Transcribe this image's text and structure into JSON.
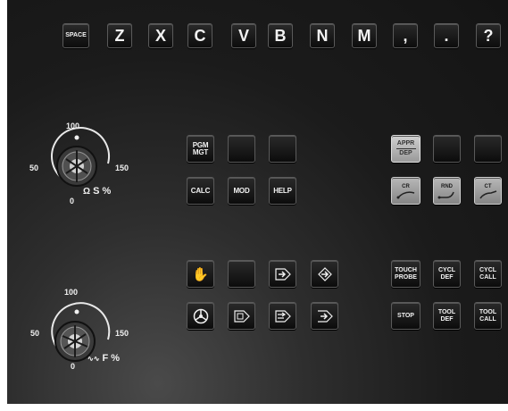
{
  "top_row": [
    "SPACE",
    "Z",
    "X",
    "C",
    "V",
    "B",
    "N",
    "M",
    ",",
    ".",
    "?"
  ],
  "spindle_dial": {
    "scale": [
      "0",
      "50",
      "100",
      "150"
    ],
    "caption": "S %"
  },
  "feed_dial": {
    "scale": [
      "0",
      "50",
      "100",
      "150"
    ],
    "caption": "F %"
  },
  "program_keys": {
    "pgm_mgt": [
      "PGM",
      "MGT"
    ],
    "calc": "CALC",
    "mod": "MOD",
    "help": "HELP"
  },
  "contour_keys": {
    "appr": "APPR",
    "dep": "DEP",
    "cr": "CR",
    "rnd": "RND",
    "ct": "CT"
  },
  "cycle_keys": {
    "touch_probe": [
      "TOUCH",
      "PROBE"
    ],
    "cycl_def": [
      "CYCL",
      "DEF"
    ],
    "cycl_call": [
      "CYCL",
      "CALL"
    ],
    "stop": "STOP",
    "tool_def": [
      "TOOL",
      "DEF"
    ],
    "tool_call": [
      "TOOL",
      "CALL"
    ]
  },
  "mode_icons": [
    "hand-icon",
    "blank",
    "program-run-icon",
    "positioning-icon",
    "handwheel-icon",
    "single-block-icon",
    "full-sequence-icon",
    "test-run-icon"
  ],
  "colors": {
    "panel": "#1b1b1b",
    "key": "#0c0c0c",
    "grey_key": "#b0b0b0"
  }
}
